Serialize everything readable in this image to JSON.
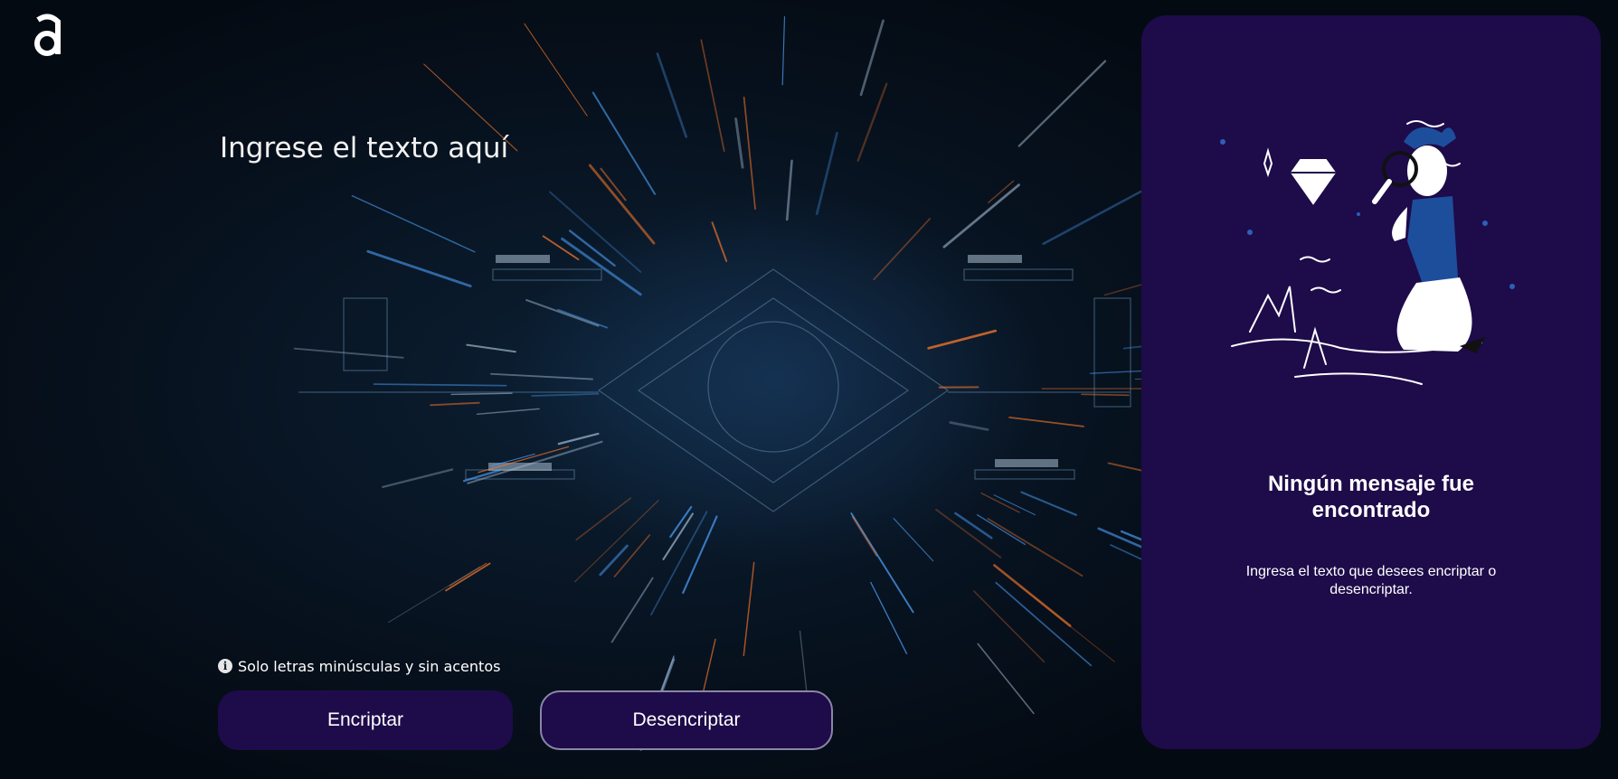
{
  "app": {
    "logo_icon": "letter-a-logo",
    "accent_color": "#1e0b4a"
  },
  "input": {
    "placeholder": "Ingrese el texto aquí",
    "value": ""
  },
  "hint": {
    "icon": "info-icon",
    "text": "Solo letras minúsculas y sin acentos"
  },
  "buttons": {
    "encrypt_label": "Encriptar",
    "decrypt_label": "Desencriptar"
  },
  "output_panel": {
    "illustration": "person-with-magnifying-glass-and-diamond",
    "title": "Ningún mensaje fue encontrado",
    "message": "Ingresa el texto que desees encriptar o desencriptar."
  }
}
